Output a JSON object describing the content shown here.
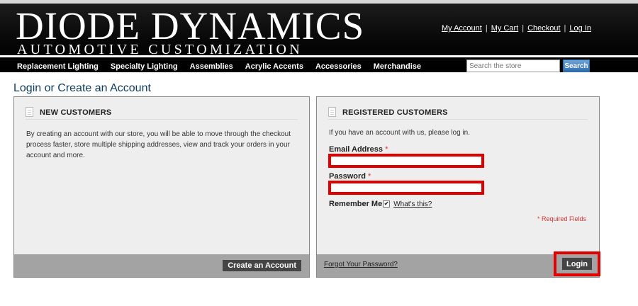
{
  "brand": {
    "title": "DIODE DYNAMICS",
    "tagline": "AUTOMOTIVE CUSTOMIZATION"
  },
  "top_links": [
    "My Account",
    "My Cart",
    "Checkout",
    "Log In"
  ],
  "nav": [
    "Replacement Lighting",
    "Specialty Lighting",
    "Assemblies",
    "Acrylic Accents",
    "Accessories",
    "Merchandise"
  ],
  "search": {
    "placeholder": "Search the store",
    "button": "Search"
  },
  "page_title": "Login or Create an Account",
  "new_customers": {
    "heading": "NEW CUSTOMERS",
    "text": "By creating an account with our store, you will be able to move through the checkout process faster, store multiple shipping addresses, view and track your orders in your account and more.",
    "button": "Create an Account"
  },
  "registered": {
    "heading": "REGISTERED CUSTOMERS",
    "intro": "If you have an account with us, please log in.",
    "email_label": "Email Address",
    "password_label": "Password",
    "required_mark": "*",
    "remember_label": "Remember Me",
    "remember_check": "✔",
    "whats_this": "What's this?",
    "required_note": "* Required Fields",
    "forgot": "Forgot Your Password?",
    "login_button": "Login"
  },
  "colors": {
    "highlight": "#e00000",
    "footer_bar": "#a3a3a3",
    "button": "#444444",
    "title": "#0e3d63"
  }
}
